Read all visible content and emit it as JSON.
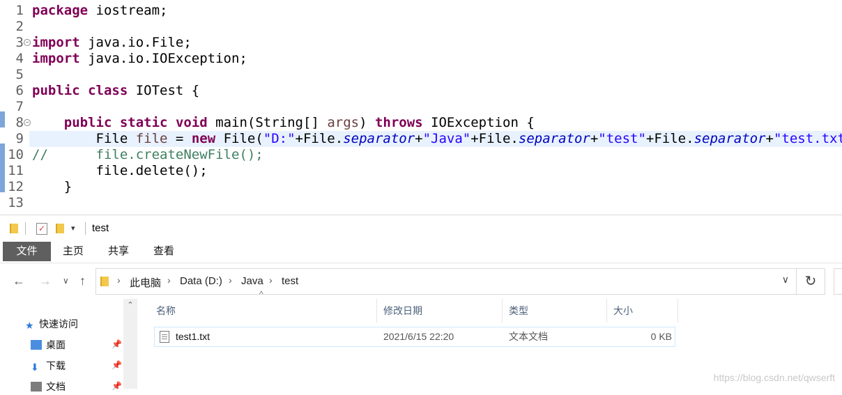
{
  "editor": {
    "lines": [
      {
        "n": "1",
        "html": "<span class=\"kw\">package</span> iostream;"
      },
      {
        "n": "2",
        "html": ""
      },
      {
        "n": "3",
        "fold": true,
        "html": "<span class=\"kw\">import</span> java.io.File;"
      },
      {
        "n": "4",
        "html": "<span class=\"kw\">import</span> java.io.IOException;"
      },
      {
        "n": "5",
        "html": ""
      },
      {
        "n": "6",
        "html": "<span class=\"kw\">public</span> <span class=\"kw\">class</span> IOTest {"
      },
      {
        "n": "7",
        "html": ""
      },
      {
        "n": "8",
        "fold": true,
        "html": "    <span class=\"kw\">public</span> <span class=\"kw\">static</span> <span class=\"kw\">void</span> main(String[] <span class=\"lv\">args</span>) <span class=\"kw\">throws</span> IOException {"
      },
      {
        "n": "9",
        "hl": true,
        "html": "        File <span class=\"lv\">file</span> = <span class=\"kw\">new</span> File(<span class=\"str\">\"D:\"</span>+File.<span class=\"sf\">separator</span>+<span class=\"str\">\"Java\"</span>+File.<span class=\"sf\">separator</span>+<span class=\"str\">\"test\"</span>+File.<span class=\"sf\">separator</span>+<span class=\"str\">\"test.txt\"</span>);"
      },
      {
        "n": "10",
        "html": "<span class=\"cm\">//      file.createNewFile();</span>"
      },
      {
        "n": "11",
        "html": "        file.delete();"
      },
      {
        "n": "12",
        "html": "    }"
      },
      {
        "n": "13",
        "html": ""
      }
    ]
  },
  "explorer": {
    "title": "test",
    "ribbon_tabs": [
      "文件",
      "主页",
      "共享",
      "查看"
    ],
    "breadcrumb": [
      "此电脑",
      "Data (D:)",
      "Java",
      "test"
    ],
    "nav_items": [
      {
        "label": "快速访问",
        "icon": "star-icon",
        "color": "#2b7ad9"
      },
      {
        "label": "桌面",
        "icon": "desktop-icon",
        "color": "#2b7ad9",
        "pinned": true
      },
      {
        "label": "下载",
        "icon": "download-icon",
        "color": "#2b7ad9",
        "pinned": true
      },
      {
        "label": "文档",
        "icon": "document-icon",
        "color": "#666",
        "pinned": true
      }
    ],
    "columns": [
      "名称",
      "修改日期",
      "类型",
      "大小"
    ],
    "files": [
      {
        "name": "test1.txt",
        "date": "2021/6/15 22:20",
        "type": "文本文档",
        "size": "0 KB"
      }
    ],
    "watermark": "https://blog.csdn.net/qwserft"
  }
}
